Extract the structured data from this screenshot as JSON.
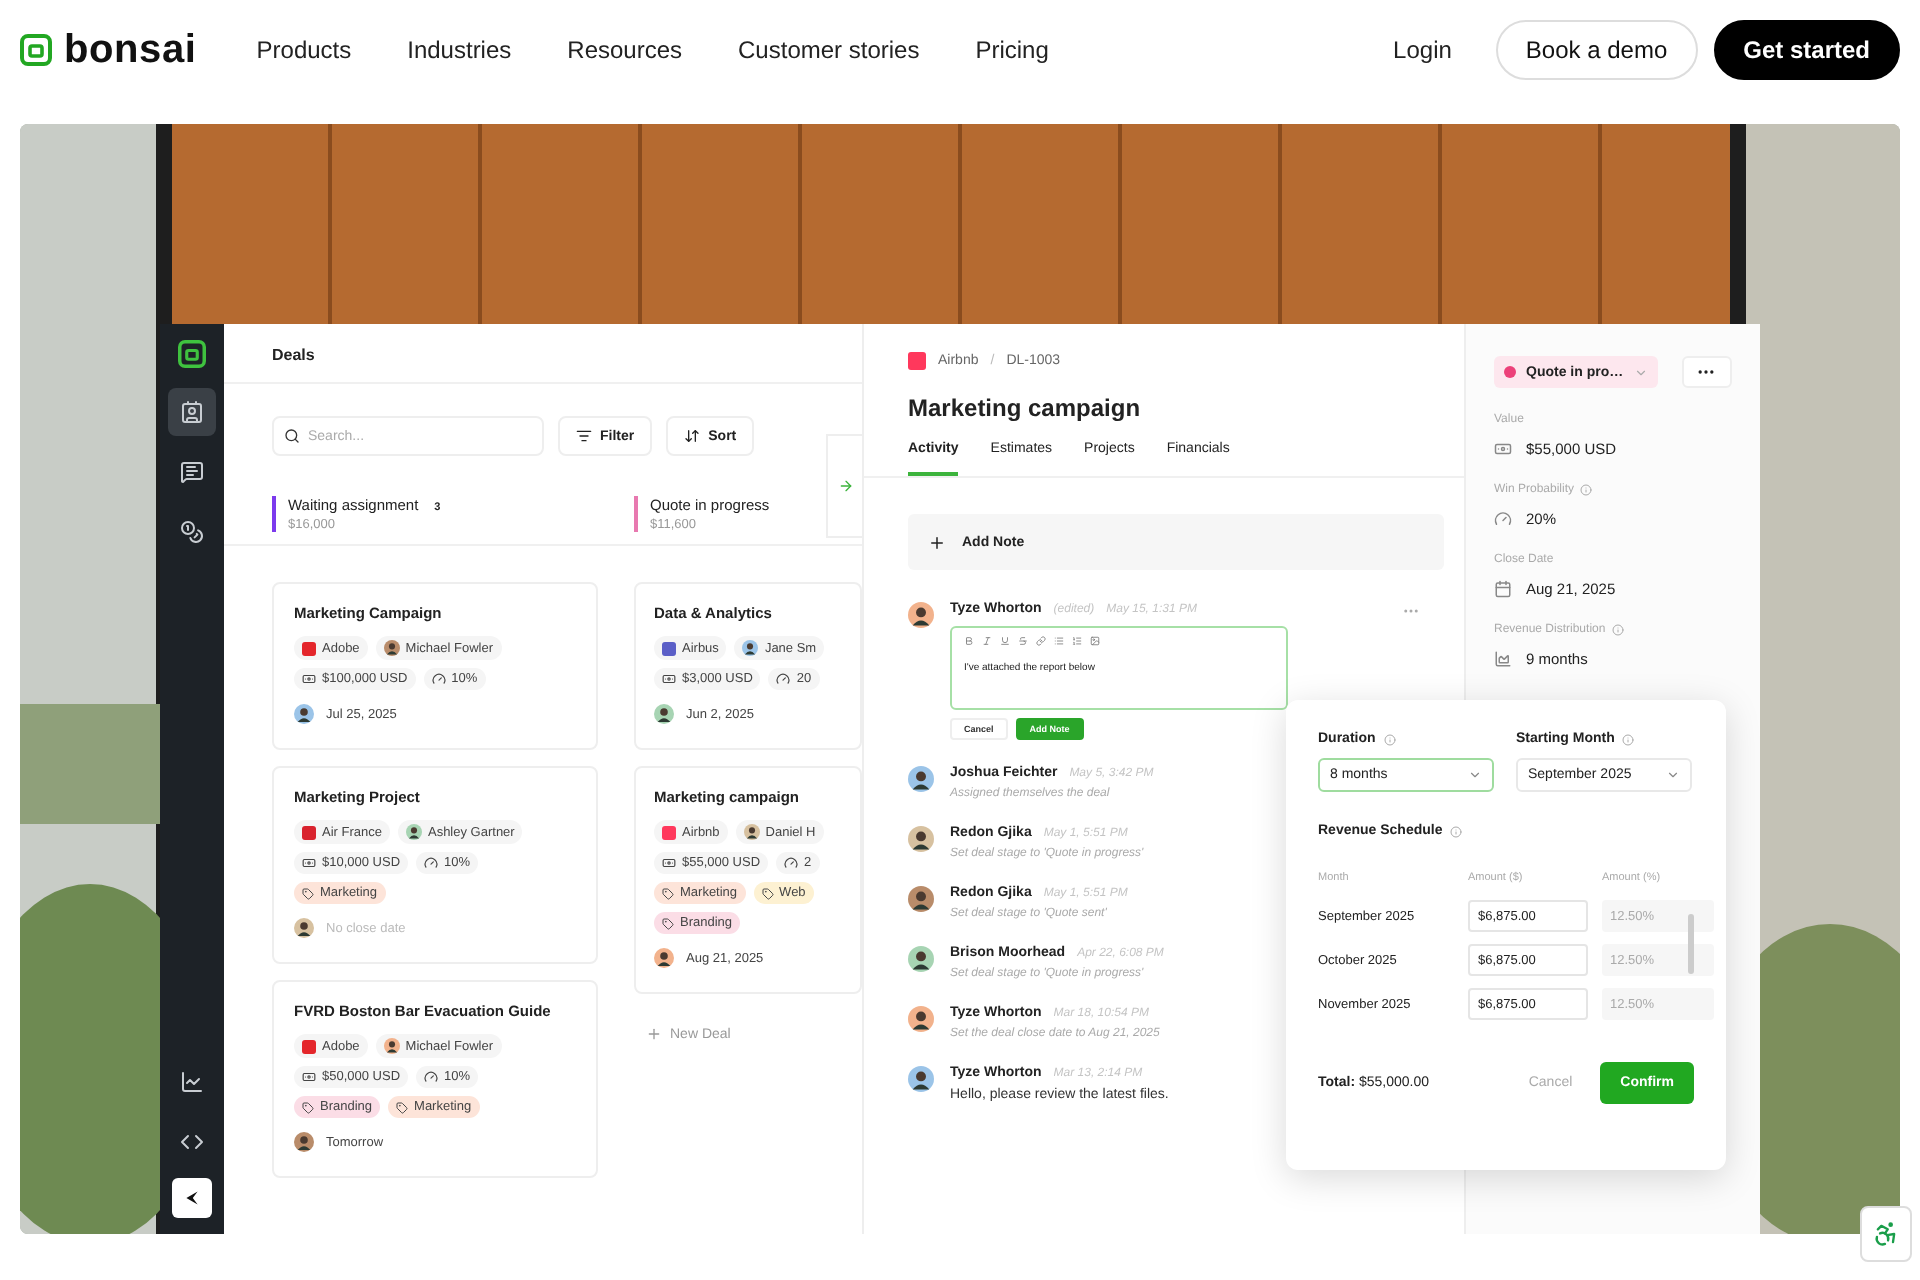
{
  "nav": {
    "logo": "bonsai",
    "links": [
      "Products",
      "Industries",
      "Resources",
      "Customer stories",
      "Pricing"
    ],
    "login": "Login",
    "demo": "Book a demo",
    "cta": "Get started"
  },
  "app": {
    "sidebar": [
      {
        "selected": true
      },
      {
        "selected": false
      },
      {
        "selected": false
      }
    ],
    "deals": {
      "title": "Deals",
      "search_placeholder": "Search...",
      "filter": "Filter",
      "sort": "Sort",
      "new_deal": "New Deal",
      "columns": [
        {
          "name": "Waiting assignment",
          "count": "3",
          "total": "$16,000",
          "color": "#7c3aed",
          "cards": [
            {
              "title": "Marketing Campaign",
              "company": {
                "name": "Adobe",
                "color": "#e4262b"
              },
              "owner": "Michael Fowler",
              "value": "$100,000 USD",
              "probability": "10%",
              "date": "Jul 25, 2025",
              "date_muted": false
            },
            {
              "title": "Marketing Project",
              "company": {
                "name": "Air France",
                "color": "#d9232e"
              },
              "owner": "Ashley Gartner",
              "value": "$10,000 USD",
              "probability": "10%",
              "tags": [
                {
                  "label": "Marketing",
                  "color": "#fde4d9"
                }
              ],
              "date": "No close date",
              "date_muted": true
            },
            {
              "title": "FVRD Boston Bar Evacuation Guide",
              "company": {
                "name": "Adobe",
                "color": "#e4262b"
              },
              "owner": "Michael Fowler",
              "value": "$50,000 USD",
              "probability": "10%",
              "tags": [
                {
                  "label": "Branding",
                  "color": "#fbdde6"
                },
                {
                  "label": "Marketing",
                  "color": "#fde4d9"
                }
              ],
              "date": "Tomorrow",
              "date_muted": false
            }
          ]
        },
        {
          "name": "Quote in progress",
          "total": "$11,600",
          "color": "#e879b0",
          "cards": [
            {
              "title": "Data & Analytics",
              "company": {
                "name": "Airbus",
                "color": "#5b5fc7"
              },
              "owner": "Jane Sm",
              "value": "$3,000 USD",
              "probability": "20",
              "date": "Jun 2, 2025",
              "date_muted": false
            },
            {
              "title": "Marketing campaign",
              "company": {
                "name": "Airbnb",
                "color": "#ff385c"
              },
              "owner": "Daniel H",
              "value": "$55,000 USD",
              "probability": "2",
              "tags": [
                {
                  "label": "Marketing",
                  "color": "#fde4d9"
                },
                {
                  "label": "Web",
                  "color": "#fdf1d2"
                },
                {
                  "label": "Branding",
                  "color": "#fbdde6"
                }
              ],
              "date": "Aug 21, 2025",
              "date_muted": false
            }
          ]
        }
      ]
    },
    "detail": {
      "company": {
        "name": "Airbnb",
        "color": "#ff385c"
      },
      "separator": "/",
      "id": "DL-1003",
      "title": "Marketing campaign",
      "tabs": [
        {
          "label": "Activity",
          "selected": true
        },
        {
          "label": "Estimates",
          "selected": false
        },
        {
          "label": "Projects",
          "selected": false
        },
        {
          "label": "Financials",
          "selected": false
        }
      ],
      "add_note": "Add Note",
      "activity": [
        {
          "kind": "editor",
          "name": "Tyze Whorton",
          "edited": "(edited)",
          "time": "May 15, 1:31 PM",
          "text": "I've attached the report below",
          "cancel": "Cancel",
          "submit": "Add Note"
        },
        {
          "kind": "event",
          "name": "Joshua Feichter",
          "time": "May 5, 3:42 PM",
          "text": "Assigned themselves the deal"
        },
        {
          "kind": "event",
          "name": "Redon Gjika",
          "time": "May 1, 5:51 PM",
          "text": "Set deal stage to 'Quote in progress'"
        },
        {
          "kind": "event",
          "name": "Redon Gjika",
          "time": "May 1, 5:51 PM",
          "text": "Set deal stage to 'Quote sent'"
        },
        {
          "kind": "event",
          "name": "Brison Moorhead",
          "time": "Apr 22, 6:08 PM",
          "text": "Set deal stage to 'Quote in progress'"
        },
        {
          "kind": "event",
          "name": "Tyze Whorton",
          "time": "Mar 18, 10:54 PM",
          "text": "Set the deal close date to Aug 21, 2025"
        },
        {
          "kind": "comment",
          "name": "Tyze Whorton",
          "time": "Mar 13, 2:14 PM",
          "text": "Hello, please review the latest files."
        }
      ]
    },
    "side": {
      "status": {
        "label": "Quote in pro…",
        "color": "#ec4079"
      },
      "fields": [
        {
          "kind": "value",
          "label": "Value",
          "info": false,
          "value": "$55,000 USD"
        },
        {
          "kind": "probability",
          "label": "Win Probability",
          "info": true,
          "value": "20%"
        },
        {
          "kind": "date",
          "label": "Close Date",
          "info": false,
          "value": "Aug 21, 2025"
        },
        {
          "kind": "distribution",
          "label": "Revenue Distribution",
          "info": true,
          "value": "9 months"
        }
      ]
    },
    "popover": {
      "selects": [
        {
          "label": "Duration",
          "value": "8 months",
          "focused": true
        },
        {
          "label": "Starting Month",
          "value": "September 2025",
          "focused": false
        }
      ],
      "schedule_label": "Revenue Schedule",
      "columns": [
        "Month",
        "Amount ($)",
        "Amount (%)"
      ],
      "rows": [
        {
          "month": "September 2025",
          "amount": "$6,875.00",
          "percent": "12.50%"
        },
        {
          "month": "October 2025",
          "amount": "$6,875.00",
          "percent": "12.50%"
        },
        {
          "month": "November 2025",
          "amount": "$6,875.00",
          "percent": "12.50%"
        }
      ],
      "total": "**Total:** $55,000.00",
      "cancel": "Cancel",
      "confirm": "Confirm"
    }
  }
}
